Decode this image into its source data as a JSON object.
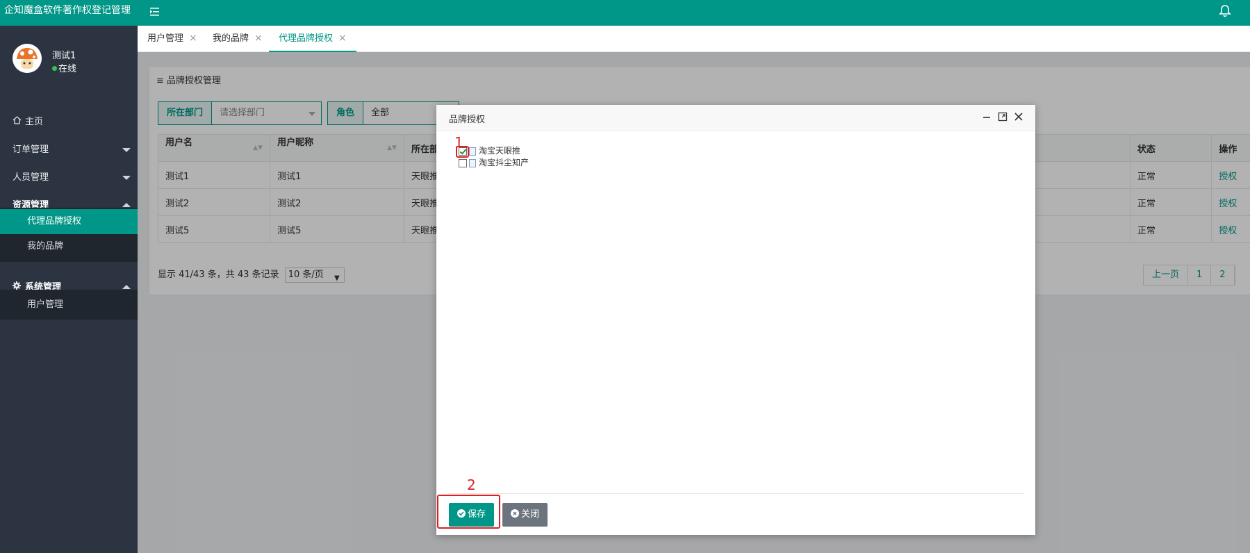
{
  "app": {
    "title": "企知魔盒软件著作权登记管理"
  },
  "user": {
    "name": "测试1",
    "status": "在线"
  },
  "sidebar": {
    "home": "主页",
    "orders": "订单管理",
    "people": "人员管理",
    "resources": "资源管理",
    "resource_sub": [
      "代理品牌授权",
      "我的品牌"
    ],
    "system": "系统管理",
    "system_sub": [
      "用户管理"
    ]
  },
  "tabs": [
    {
      "label": "用户管理",
      "close": "×"
    },
    {
      "label": "我的品牌",
      "close": "×"
    },
    {
      "label": "代理品牌授权",
      "close": "×"
    }
  ],
  "panel": {
    "title": "品牌授权管理"
  },
  "filters": {
    "dept_label": "所在部门",
    "dept_placeholder": "请选择部门",
    "role_label": "角色",
    "role_value": "全部"
  },
  "table": {
    "headers": [
      "用户名",
      "用户昵称",
      "所在部",
      "状态",
      "操作"
    ],
    "rows": [
      [
        "测试1",
        "测试1",
        "天眼推",
        "正常",
        "授权"
      ],
      [
        "测试2",
        "测试2",
        "天眼推",
        "正常",
        "授权"
      ],
      [
        "测试5",
        "测试5",
        "天眼推",
        "正常",
        "授权"
      ]
    ]
  },
  "pager": {
    "info": "显示 41/43 条，共 43 条记录",
    "page_size": "10 条/页",
    "prev": "上一页",
    "pages": [
      "1",
      "2"
    ]
  },
  "modal": {
    "title": "品牌授权",
    "tree": [
      {
        "label": "淘宝天眼推",
        "checked": true
      },
      {
        "label": "淘宝抖尘知产",
        "checked": false
      }
    ],
    "save_label": "保存",
    "close_label": "关闭",
    "markers": [
      "1",
      "2"
    ]
  },
  "colors": {
    "primary": "#009688",
    "sidebar": "#2b3440",
    "marker": "#e02020"
  }
}
